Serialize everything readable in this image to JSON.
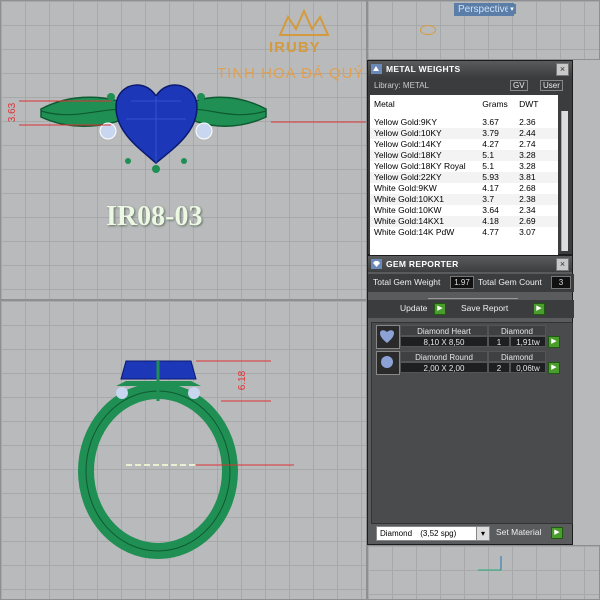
{
  "viewport": {
    "label": "Perspective"
  },
  "branding": {
    "logo": "IRUBY",
    "slogan": "TINH HOA ĐÁ QUÝ",
    "model_code": "IR08-03"
  },
  "dimensions": {
    "top_height": "3.63",
    "side_height": "6.18"
  },
  "metal_weights": {
    "title": "METAL WEIGHTS",
    "library_label": "Library: METAL",
    "btn_gv": "GV",
    "btn_user": "User",
    "headers": [
      "Metal",
      "Grams",
      "DWT"
    ],
    "rows": [
      [
        "Yellow Gold:9KY",
        "3.67",
        "2.36"
      ],
      [
        "Yellow Gold:10KY",
        "3.79",
        "2.44"
      ],
      [
        "Yellow Gold:14KY",
        "4.27",
        "2.74"
      ],
      [
        "Yellow Gold:18KY",
        "5.1",
        "3.28"
      ],
      [
        "Yellow Gold:18KY Royal",
        "5.1",
        "3.28"
      ],
      [
        "Yellow Gold:22KY",
        "5.93",
        "3.81"
      ],
      [
        "White Gold:9KW",
        "4.17",
        "2.68"
      ],
      [
        "White Gold:10KX1",
        "3.7",
        "2.38"
      ],
      [
        "White Gold:10KW",
        "3.64",
        "2.34"
      ],
      [
        "White Gold:14KX1",
        "4.18",
        "2.69"
      ],
      [
        "White Gold:14K PdW",
        "4.77",
        "3.07"
      ]
    ]
  },
  "gem_reporter": {
    "title": "GEM REPORTER",
    "total_weight_label": "Total Gem Weight",
    "total_weight_value": "1.97",
    "total_count_label": "Total Gem Count",
    "total_count_value": "3",
    "update_label": "Update",
    "save_report_label": "Save Report",
    "gems": [
      {
        "shape": "Diamond Heart",
        "size": "8,10 X 8,50",
        "material": "Diamond",
        "count": "1",
        "weight": "1,91tw"
      },
      {
        "shape": "Diamond Round",
        "size": "2,00 X 2,00",
        "material": "Diamond",
        "count": "2",
        "weight": "0,06tw"
      }
    ],
    "material_select": "Diamond",
    "material_spg": "(3,52 spg)",
    "set_material_label": "Set Material"
  },
  "colors": {
    "ring_metal": "#1f8f54",
    "sapphire": "#1c37b8",
    "panel_bg": "#3b3c3d",
    "accent_button": "#4a9d2c"
  },
  "icons": [
    "crown-logo-icon",
    "metal-weights-icon",
    "gem-reporter-icon",
    "close-icon",
    "play-icon",
    "dropdown-arrow-icon",
    "axis-gizmo-icon"
  ]
}
